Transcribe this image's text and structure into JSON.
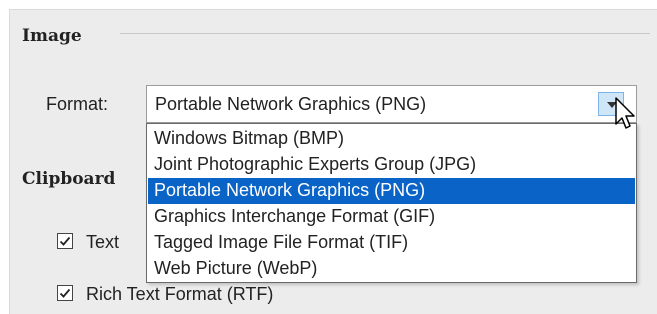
{
  "image_section": {
    "title": "Image",
    "format_label": "Format:",
    "format_value": "Portable Network Graphics (PNG)",
    "format_options": [
      "Windows Bitmap (BMP)",
      "Joint Photographic Experts Group (JPG)",
      "Portable Network Graphics (PNG)",
      "Graphics Interchange Format (GIF)",
      "Tagged Image File Format (TIF)",
      "Web Picture (WebP)"
    ],
    "selected_index": 2
  },
  "clipboard_section": {
    "title": "Clipboard",
    "options": [
      {
        "label": "Text",
        "checked": true
      },
      {
        "label": "Rich Text Format (RTF)",
        "checked": true
      }
    ]
  },
  "colors": {
    "selection": "#0a64c8",
    "panel": "#ececec"
  }
}
